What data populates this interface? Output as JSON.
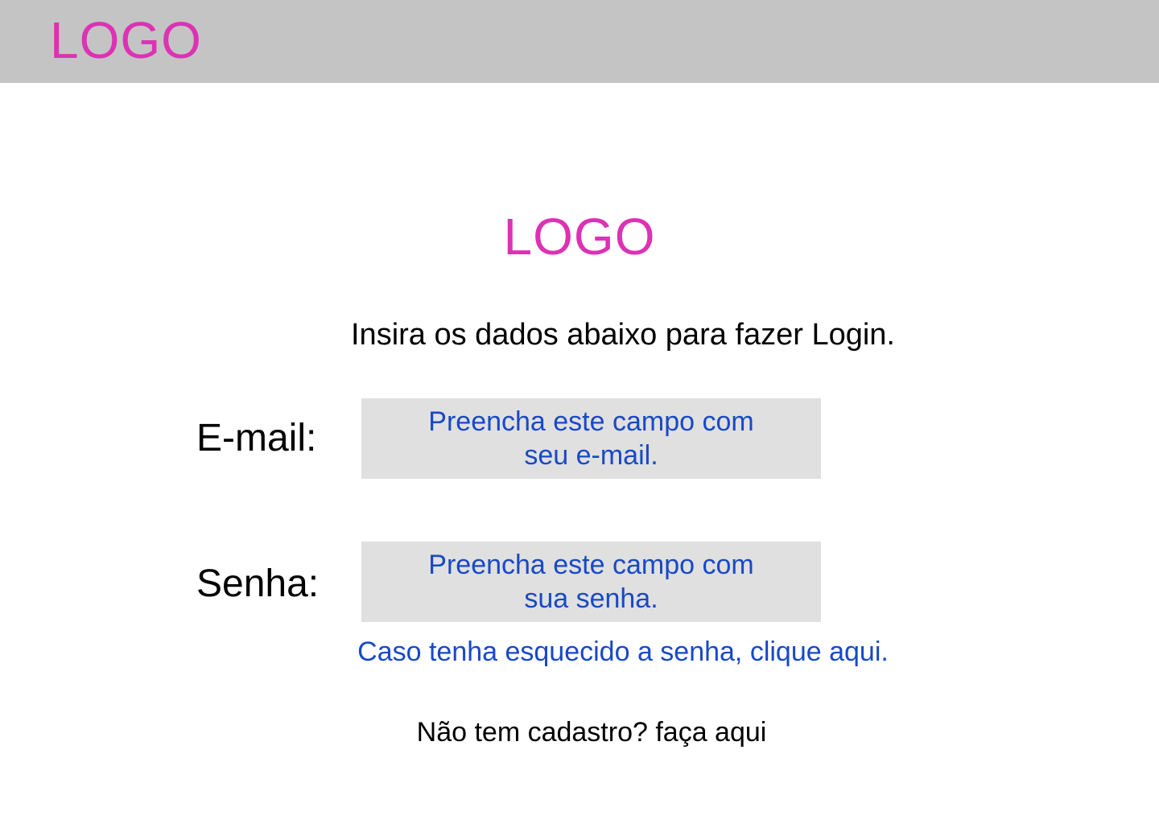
{
  "header": {
    "logo_text": "LOGO"
  },
  "main": {
    "logo_text": "LOGO",
    "instructions": "Insira os dados abaixo para fazer Login.",
    "email": {
      "label": "E-mail:",
      "placeholder": "Preencha este campo com seu e-mail."
    },
    "password": {
      "label": "Senha:",
      "placeholder": "Preencha este campo com sua senha."
    },
    "forgot_password_link": "Caso tenha esquecido a senha, clique aqui.",
    "signup_link": "Não tem cadastro? faça aqui"
  },
  "colors": {
    "header_bg": "#c4c4c4",
    "logo": "#dc32b4",
    "link_blue": "#1849c7",
    "field_bg": "#e0e0e0"
  }
}
